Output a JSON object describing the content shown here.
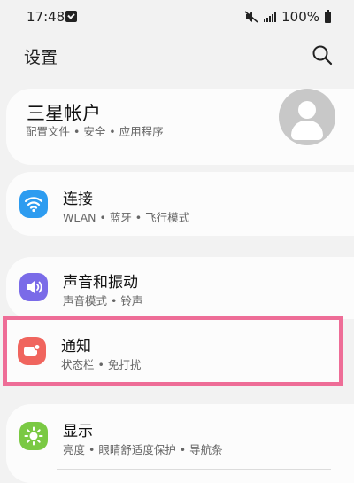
{
  "status_bar": {
    "time": "17:48",
    "battery": "100%"
  },
  "header": {
    "title": "设置"
  },
  "account": {
    "title": "三星帐户",
    "subtitle": "配置文件 • 安全 • 应用程序"
  },
  "items": [
    {
      "title": "连接",
      "subtitle": "WLAN • 蓝牙 • 飞行模式",
      "icon": "wifi-icon",
      "color": "#2d9cf0"
    },
    {
      "title": "声音和振动",
      "subtitle": "声音模式 • 铃声",
      "icon": "speaker-icon",
      "color": "#7a6be8"
    },
    {
      "title": "通知",
      "subtitle": "状态栏 • 免打扰",
      "icon": "notification-icon",
      "color": "#f0655e"
    },
    {
      "title": "显示",
      "subtitle": "亮度 • 眼睛舒适度保护 • 导航条",
      "icon": "brightness-icon",
      "color": "#7ac943"
    }
  ],
  "highlight_color": "#ee6d97"
}
